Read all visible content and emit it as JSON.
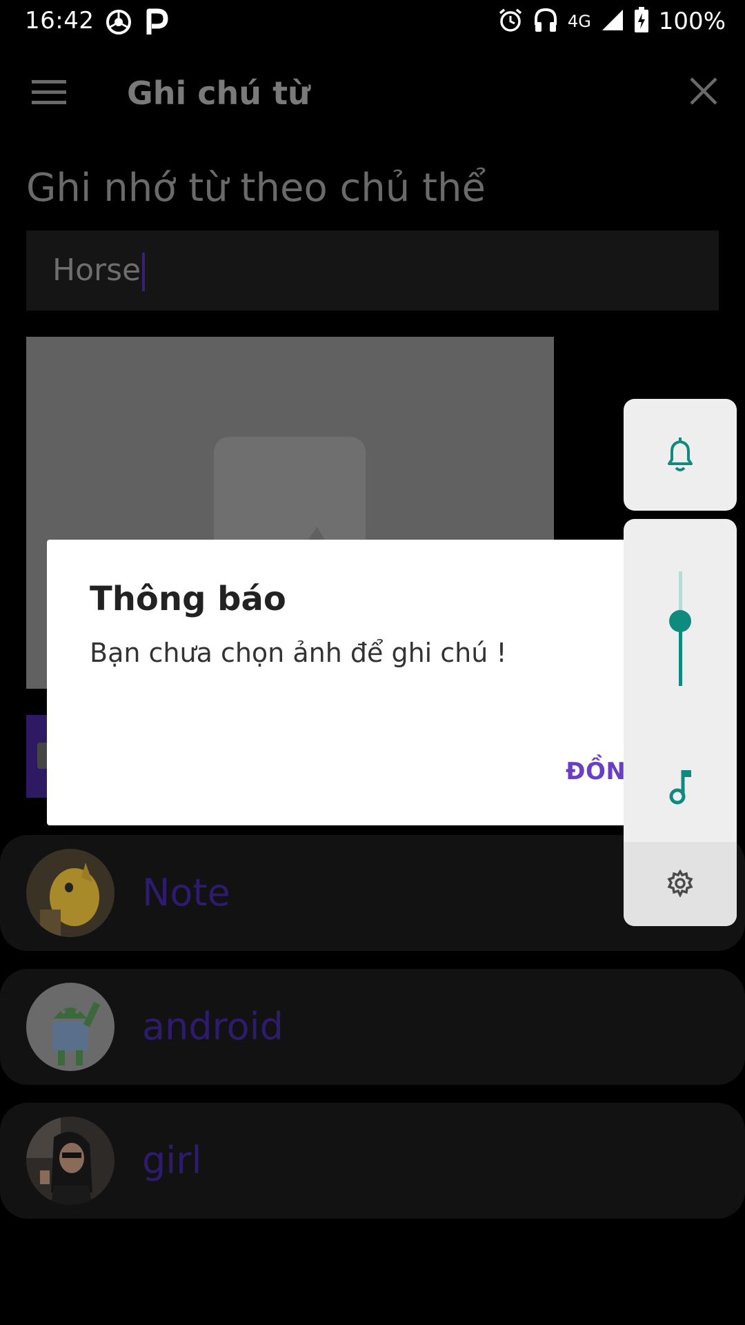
{
  "status_bar": {
    "time": "16:42",
    "network": "4G",
    "battery": "100%",
    "icons": [
      "chrome-like-icon",
      "p-icon",
      "alarm-icon",
      "headset-icon",
      "signal-icon",
      "battery-charging-icon"
    ]
  },
  "toolbar": {
    "menu_icon": "menu-icon",
    "title": "Ghi chú từ",
    "close_icon": "close-icon"
  },
  "content": {
    "heading": "Ghi nhớ từ theo chủ thể",
    "input_value": "Horse"
  },
  "list": {
    "items": [
      {
        "label": "Note"
      },
      {
        "label": "android"
      },
      {
        "label": "girl"
      }
    ]
  },
  "dialog": {
    "title": "Thông báo",
    "message": "Bạn chưa chọn ảnh để ghi chú !",
    "ok_button": "ĐỒNG Ý"
  },
  "volume_panel": {
    "accent_color": "#0f8a7e",
    "level": 0.5,
    "icons": [
      "bell-icon",
      "music-note-icon",
      "settings-gear-icon"
    ]
  },
  "colors": {
    "accent_purple": "#6a3fc4",
    "teal": "#0f8a7e"
  }
}
